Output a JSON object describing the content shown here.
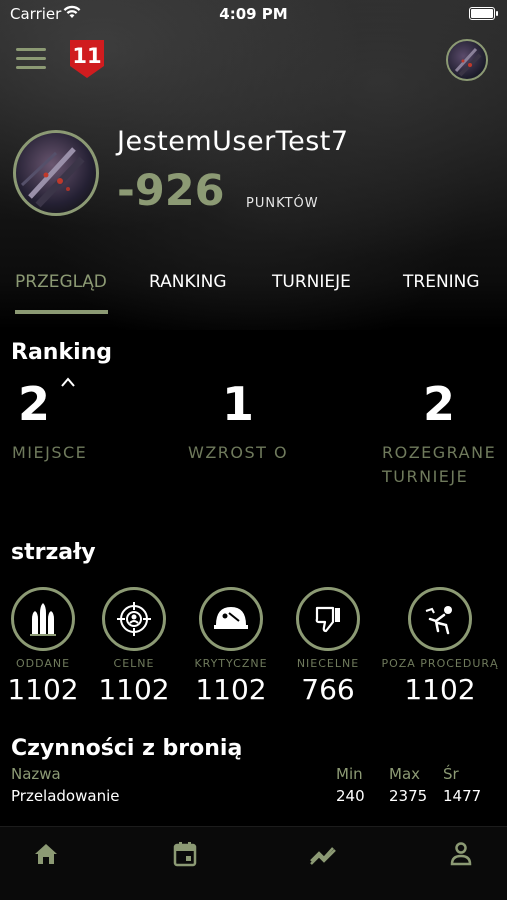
{
  "status_bar": {
    "carrier": "Carrier",
    "time": "4:09 PM"
  },
  "header": {
    "logo_text": "11",
    "menu_icon": "hamburger-menu-icon",
    "avatar_icon": "user-avatar"
  },
  "profile": {
    "username": "JestemUserTest7",
    "points": "-926",
    "points_label": "PUNKTÓW"
  },
  "tabs": [
    {
      "label": "PRZEGLĄD",
      "active": true
    },
    {
      "label": "RANKING",
      "active": false
    },
    {
      "label": "TURNIEJE",
      "active": false
    },
    {
      "label": "TRENING",
      "active": false
    }
  ],
  "ranking": {
    "title": "Ranking",
    "stats": [
      {
        "value": "2",
        "label_lines": [
          "MIEJSCE"
        ],
        "trend_icon": "caret-up-icon"
      },
      {
        "value": "1",
        "label_lines": [
          "WZROST O"
        ]
      },
      {
        "value": "2",
        "label_lines": [
          "ROZEGRANE",
          "TURNIEJE"
        ]
      }
    ]
  },
  "shots": {
    "title": "strzały",
    "items": [
      {
        "label": "ODDANE",
        "value": "1102",
        "icon": "bullets-icon"
      },
      {
        "label": "CELNE",
        "value": "1102",
        "icon": "target-icon"
      },
      {
        "label": "KRYTYCZNE",
        "value": "1102",
        "icon": "helmet-icon"
      },
      {
        "label": "NIECELNE",
        "value": "766",
        "icon": "thumbs-down-icon"
      },
      {
        "label": "POZA PROCEDURĄ",
        "value": "1102",
        "icon": "procedure-icon"
      }
    ]
  },
  "weapon_ops": {
    "title": "Czynności z bronią",
    "headers": {
      "name": "Nazwa",
      "min": "Min",
      "max": "Max",
      "avg": "Śr"
    },
    "rows": [
      {
        "name": "Przeladowanie",
        "min": "240",
        "max": "2375",
        "avg": "1477"
      }
    ]
  },
  "bottom_nav": [
    {
      "name": "home",
      "icon": "home-icon"
    },
    {
      "name": "calendar",
      "icon": "calendar-icon"
    },
    {
      "name": "stats",
      "icon": "trend-icon"
    },
    {
      "name": "profile",
      "icon": "person-icon"
    }
  ],
  "colors": {
    "accent": "#8c9a74",
    "muted": "#6f7a5c",
    "brand_red": "#d01c1f",
    "background": "#000000"
  }
}
